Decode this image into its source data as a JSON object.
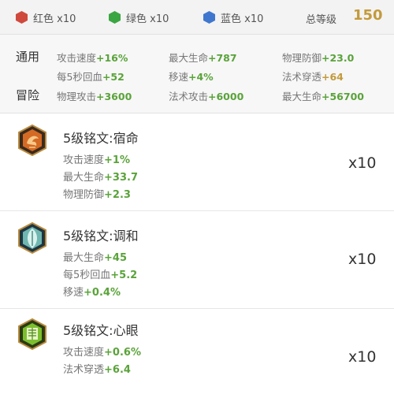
{
  "gems": [
    {
      "label": "红色 x10",
      "color": "#cf4a3c"
    },
    {
      "label": "绿色 x10",
      "color": "#3aa642"
    },
    {
      "label": "蓝色 x10",
      "color": "#3f77cf"
    }
  ],
  "total": {
    "label": "总等级",
    "value": "150"
  },
  "stats": {
    "general_label": "通用",
    "adventure_label": "冒险",
    "general": [
      {
        "name": "攻击速度",
        "value": "+16%"
      },
      {
        "name": "最大生命",
        "value": "+787"
      },
      {
        "name": "物理防御",
        "value": "+23.0"
      },
      {
        "name": "每5秒回血",
        "value": "+52"
      },
      {
        "name": "移速",
        "value": "+4%"
      },
      {
        "name": "法术穿透",
        "value": "+64"
      }
    ],
    "adventure": [
      {
        "name": "物理攻击",
        "value": "+3600"
      },
      {
        "name": "法术攻击",
        "value": "+6000"
      },
      {
        "name": "最大生命",
        "value": "+56700"
      }
    ]
  },
  "runes": [
    {
      "name": "5级铭文:宿命",
      "count": "x10",
      "icon": "destiny-rune-icon",
      "attrs": [
        {
          "name": "攻击速度",
          "value": "+1%"
        },
        {
          "name": "最大生命",
          "value": "+33.7"
        },
        {
          "name": "物理防御",
          "value": "+2.3"
        }
      ]
    },
    {
      "name": "5级铭文:调和",
      "count": "x10",
      "icon": "harmony-rune-icon",
      "attrs": [
        {
          "name": "最大生命",
          "value": "+45"
        },
        {
          "name": "每5秒回血",
          "value": "+5.2"
        },
        {
          "name": "移速",
          "value": "+0.4%"
        }
      ]
    },
    {
      "name": "5级铭文:心眼",
      "count": "x10",
      "icon": "insight-rune-icon",
      "attrs": [
        {
          "name": "攻击速度",
          "value": "+0.6%"
        },
        {
          "name": "法术穿透",
          "value": "+6.4"
        }
      ]
    }
  ]
}
